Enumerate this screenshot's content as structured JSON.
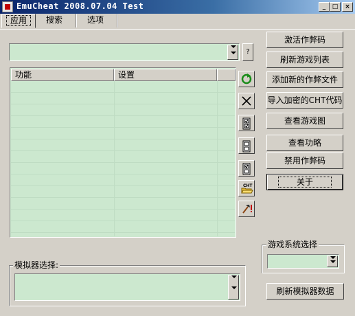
{
  "window": {
    "title": "EmuCheat  2008.07.04 Test",
    "controls": [
      "_",
      "□",
      "×"
    ]
  },
  "tabs": [
    {
      "label": "应用",
      "active": true
    },
    {
      "label": "搜索",
      "active": false
    },
    {
      "label": "选项",
      "active": false
    }
  ],
  "game_select": {
    "value": "",
    "help_label": "?"
  },
  "cheat_list": {
    "columns": [
      "功能",
      "设置"
    ],
    "rows": []
  },
  "side_icons": [
    "refresh-icon",
    "delete-icon",
    "check-all-icon",
    "uncheck-all-icon",
    "toggle-check-icon",
    "open-cht-file-icon",
    "tools-icon"
  ],
  "side_icon_labels": {
    "open_cht": "CHT"
  },
  "buttons": {
    "activate": "激活作弊码",
    "refresh_games": "刷新游戏列表",
    "add_cheat_file": "添加新的作弊文件",
    "import_cht": "导入加密的CHT代码",
    "view_game_image": "查看游戏图",
    "view_guide": "查看功略",
    "disable_cheats": "禁用作弊码",
    "about": "关于",
    "refresh_emulator": "刷新模拟器数据"
  },
  "emulator_group": {
    "label": "模拟器选择:",
    "value": ""
  },
  "system_group": {
    "label": "游戏系统选择",
    "value": ""
  }
}
